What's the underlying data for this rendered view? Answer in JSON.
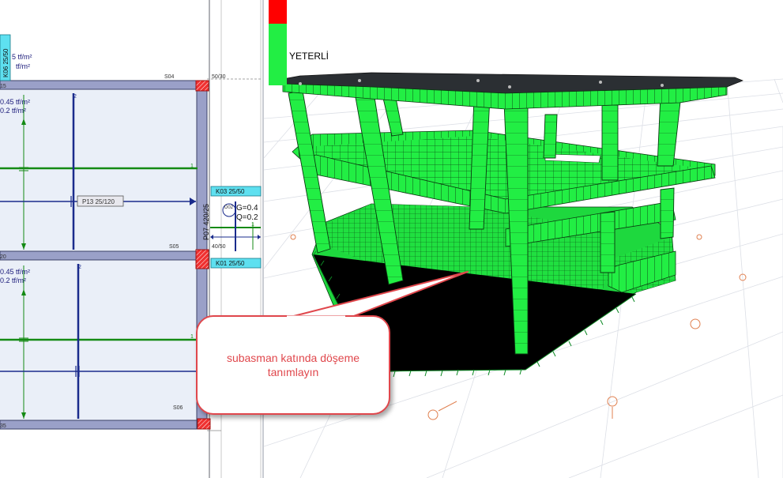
{
  "plan": {
    "top_load_line1": "5 tf/m²",
    "top_load_line2": "tf/m²",
    "top_beam_label": "K06 25/50",
    "corner_label_1": "15",
    "corner_label_2": "20",
    "corner_label_3": "35",
    "beam_s04": "S04",
    "beam_s05": "S05",
    "beam_s06": "S06",
    "dim_50_30": "50/30",
    "dim_40_50": "40/50",
    "slab1_g": "0.45 tf/m²",
    "slab1_q": "0.2 tf/m²",
    "slab2_g": "0.45 tf/m²",
    "slab2_q": "0.2 tf/m²",
    "marker_2a": "2",
    "marker_2b": "2",
    "marker_1a": "1",
    "marker_1b": "1",
    "marker_1c": "1",
    "beam_p13": "P13 25/120",
    "beam_k03": "K03 25/50",
    "beam_k01": "K01 25/50",
    "column_p07": "P07 420/25",
    "d02_label": "D02",
    "g_load": "G=0.4",
    "q_load": "Q=0.2"
  },
  "legend": {
    "label": "YETERLİ",
    "colors": {
      "red": "#ff0000",
      "green": "#22ee44"
    }
  },
  "callout": {
    "text": "subasman katında döşeme tanımlayın"
  },
  "colors": {
    "beam_fill": "#9aa0c8",
    "column_red": "#e8202a",
    "axis_green": "#148a14",
    "rebar_blue": "#1a2b8c",
    "label_cyan": "#5ee0f0",
    "model_green": "#22ee44",
    "callout_red": "#e0474c"
  }
}
